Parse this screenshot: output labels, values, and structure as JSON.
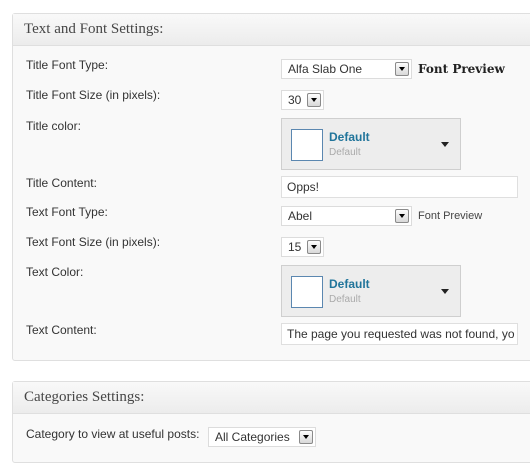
{
  "text_font_settings": {
    "title": "Text and Font Settings:",
    "title_font_type": {
      "label": "Title Font Type:",
      "value": "Alfa Slab One",
      "preview": "Font Preview"
    },
    "title_font_size": {
      "label": "Title Font Size (in pixels):",
      "value": "30"
    },
    "title_color": {
      "label": "Title color:",
      "name": "Default",
      "sub": "Default"
    },
    "title_content": {
      "label": "Title Content:",
      "value": "Opps!"
    },
    "text_font_type": {
      "label": "Text Font Type:",
      "value": "Abel",
      "preview": "Font Preview"
    },
    "text_font_size": {
      "label": "Text Font Size (in pixels):",
      "value": "15"
    },
    "text_color": {
      "label": "Text Color:",
      "name": "Default",
      "sub": "Default"
    },
    "text_content": {
      "label": "Text Content:",
      "value": "The page you requested was not found, yo"
    }
  },
  "categories_settings": {
    "title": "Categories Settings:",
    "category": {
      "label": "Category to view at useful posts:",
      "value": "All Categories"
    }
  }
}
